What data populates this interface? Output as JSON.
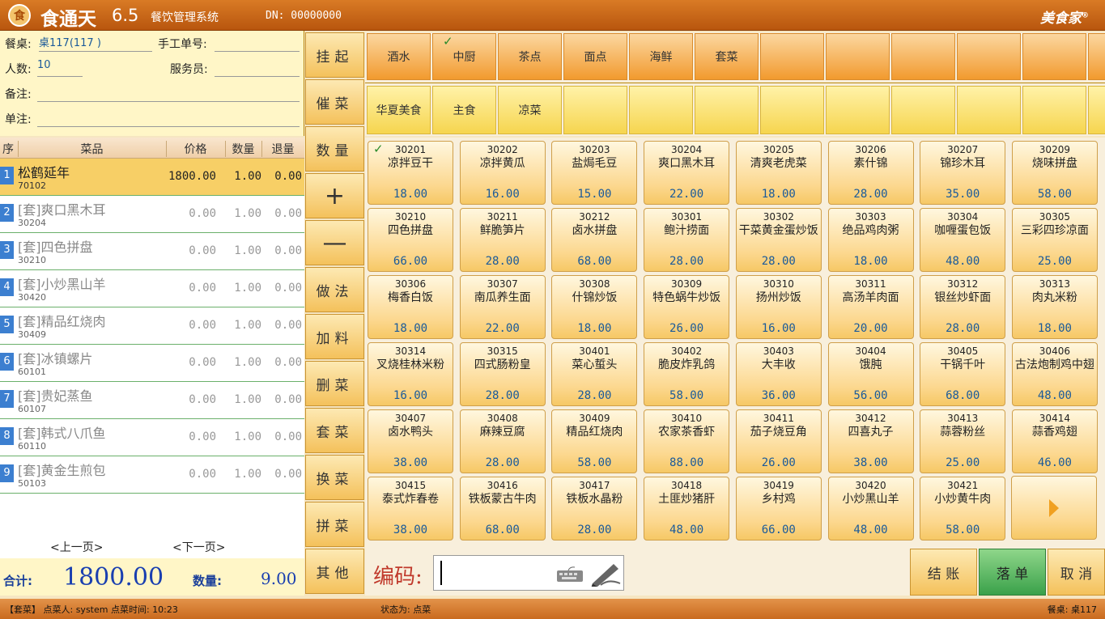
{
  "titlebar": {
    "logo_glyph": "食",
    "app_name": "食通天",
    "version": "6.5",
    "subtitle": "餐饮管理系统",
    "dn": "DN: 00000000",
    "brand": "美食家",
    "brand_mark": "®"
  },
  "order_info": {
    "table_label": "餐桌:",
    "table_value": "桌117(117 )",
    "manual_no_label": "手工单号:",
    "manual_no_value": "",
    "people_label": "人数:",
    "people_value": "10",
    "waiter_label": "服务员:",
    "waiter_value": "",
    "remark_label": "备注:",
    "remark_value": "",
    "order_note_label": "单注:",
    "order_note_value": ""
  },
  "order_grid": {
    "columns": [
      "序",
      "菜品",
      "价格",
      "数量",
      "退量"
    ],
    "rows": [
      {
        "no": "1",
        "name": "松鹤延年",
        "code": "70102",
        "price": "1800.00",
        "qty": "1.00",
        "ret": "0.00"
      },
      {
        "no": "2",
        "name": "[套]爽口黑木耳",
        "code": "30204",
        "price": "0.00",
        "qty": "1.00",
        "ret": "0.00"
      },
      {
        "no": "3",
        "name": "[套]四色拼盘",
        "code": "30210",
        "price": "0.00",
        "qty": "1.00",
        "ret": "0.00"
      },
      {
        "no": "4",
        "name": "[套]小炒黑山羊",
        "code": "30420",
        "price": "0.00",
        "qty": "1.00",
        "ret": "0.00"
      },
      {
        "no": "5",
        "name": "[套]精品红烧肉",
        "code": "30409",
        "price": "0.00",
        "qty": "1.00",
        "ret": "0.00"
      },
      {
        "no": "6",
        "name": "[套]冰镇螺片",
        "code": "60101",
        "price": "0.00",
        "qty": "1.00",
        "ret": "0.00"
      },
      {
        "no": "7",
        "name": "[套]贵妃蒸鱼",
        "code": "60107",
        "price": "0.00",
        "qty": "1.00",
        "ret": "0.00"
      },
      {
        "no": "8",
        "name": "[套]韩式八爪鱼",
        "code": "60110",
        "price": "0.00",
        "qty": "1.00",
        "ret": "0.00"
      },
      {
        "no": "9",
        "name": "[套]黄金生煎包",
        "code": "50103",
        "price": "0.00",
        "qty": "1.00",
        "ret": "0.00"
      }
    ],
    "prev_page": "<上一页>",
    "next_page": "<下一页>"
  },
  "totals": {
    "total_label": "合计:",
    "total_value": "1800.00",
    "qty_label": "数量:",
    "qty_value": "9.00"
  },
  "side_buttons": [
    "挂起",
    "催菜",
    "数量",
    "+",
    "—",
    "做法",
    "加料",
    "删菜",
    "套菜",
    "换菜",
    "拼菜",
    "其他"
  ],
  "categories_row1": [
    "酒水",
    "中厨",
    "茶点",
    "面点",
    "海鲜",
    "套菜",
    "",
    "",
    "",
    "",
    "",
    ""
  ],
  "categories_row1_checked_index": 1,
  "categories_row2": [
    "华夏美食",
    "主食",
    "凉菜",
    "",
    "",
    "",
    "",
    "",
    "",
    "",
    "",
    ""
  ],
  "dishes": [
    {
      "code": "30201",
      "name": "凉拌豆干",
      "price": "18.00",
      "checked": true
    },
    {
      "code": "30202",
      "name": "凉拌黄瓜",
      "price": "16.00"
    },
    {
      "code": "30203",
      "name": "盐焗毛豆",
      "price": "15.00"
    },
    {
      "code": "30204",
      "name": "爽口黑木耳",
      "price": "22.00"
    },
    {
      "code": "30205",
      "name": "清爽老虎菜",
      "price": "18.00"
    },
    {
      "code": "30206",
      "name": "素什锦",
      "price": "28.00"
    },
    {
      "code": "30207",
      "name": "锦珍木耳",
      "price": "35.00"
    },
    {
      "code": "30209",
      "name": "烧味拼盘",
      "price": "58.00"
    },
    {
      "code": "30210",
      "name": "四色拼盘",
      "price": "66.00"
    },
    {
      "code": "30211",
      "name": "鲜脆笋片",
      "price": "28.00"
    },
    {
      "code": "30212",
      "name": "卤水拼盘",
      "price": "68.00"
    },
    {
      "code": "30301",
      "name": "鲍汁捞面",
      "price": "28.00"
    },
    {
      "code": "30302",
      "name": "干菜黄金蛋炒饭",
      "price": "28.00"
    },
    {
      "code": "30303",
      "name": "绝品鸡肉粥",
      "price": "18.00"
    },
    {
      "code": "30304",
      "name": "咖喱蛋包饭",
      "price": "48.00"
    },
    {
      "code": "30305",
      "name": "三彩四珍凉面",
      "price": "25.00"
    },
    {
      "code": "30306",
      "name": "梅香白饭",
      "price": "18.00"
    },
    {
      "code": "30307",
      "name": "南瓜养生面",
      "price": "22.00"
    },
    {
      "code": "30308",
      "name": "什锦炒饭",
      "price": "18.00"
    },
    {
      "code": "30309",
      "name": "特色蜗牛炒饭",
      "price": "26.00"
    },
    {
      "code": "30310",
      "name": "扬州炒饭",
      "price": "16.00"
    },
    {
      "code": "30311",
      "name": "高汤羊肉面",
      "price": "20.00"
    },
    {
      "code": "30312",
      "name": "银丝炒虾面",
      "price": "28.00"
    },
    {
      "code": "30313",
      "name": "肉丸米粉",
      "price": "18.00"
    },
    {
      "code": "30314",
      "name": "叉烧桂林米粉",
      "price": "16.00"
    },
    {
      "code": "30315",
      "name": "四式肠粉皇",
      "price": "28.00"
    },
    {
      "code": "30401",
      "name": "菜心蜇头",
      "price": "28.00"
    },
    {
      "code": "30402",
      "name": "脆皮炸乳鸽",
      "price": "58.00"
    },
    {
      "code": "30403",
      "name": "大丰收",
      "price": "36.00"
    },
    {
      "code": "30404",
      "name": "饿肫",
      "price": "56.00"
    },
    {
      "code": "30405",
      "name": "干锅千叶",
      "price": "68.00"
    },
    {
      "code": "30406",
      "name": "古法炮制鸡中翅",
      "price": "48.00"
    },
    {
      "code": "30407",
      "name": "卤水鸭头",
      "price": "38.00"
    },
    {
      "code": "30408",
      "name": "麻辣豆腐",
      "price": "28.00"
    },
    {
      "code": "30409",
      "name": "精品红烧肉",
      "price": "58.00"
    },
    {
      "code": "30410",
      "name": "农家茶香虾",
      "price": "88.00"
    },
    {
      "code": "30411",
      "name": "茄子烧豆角",
      "price": "26.00"
    },
    {
      "code": "30412",
      "name": "四喜丸子",
      "price": "38.00"
    },
    {
      "code": "30413",
      "name": "蒜蓉粉丝",
      "price": "25.00"
    },
    {
      "code": "30414",
      "name": "蒜香鸡翅",
      "price": "46.00"
    },
    {
      "code": "30415",
      "name": "泰式炸春卷",
      "price": "38.00"
    },
    {
      "code": "30416",
      "name": "铁板蒙古牛肉",
      "price": "68.00"
    },
    {
      "code": "30417",
      "name": "铁板水晶粉",
      "price": "28.00"
    },
    {
      "code": "30418",
      "name": "土匪炒猪肝",
      "price": "48.00"
    },
    {
      "code": "30419",
      "name": "乡村鸡",
      "price": "66.00"
    },
    {
      "code": "30420",
      "name": "小炒黑山羊",
      "price": "48.00"
    },
    {
      "code": "30421",
      "name": "小炒黄牛肉",
      "price": "58.00"
    }
  ],
  "code_input": {
    "label": "编码:",
    "value": "",
    "keyboard_icon": "keyboard-icon",
    "handwriting_icon": "pen-icon"
  },
  "actions": {
    "checkout": "结 账",
    "submit": "落 单",
    "cancel": "取 消"
  },
  "status": {
    "left": "【套菜】 点菜人: system  点菜时间: 10:23",
    "middle": "状态为: 点菜",
    "right": "餐桌: 桌117"
  },
  "colors": {
    "title_bg": "#c96a1e",
    "selected_row": "#f7cf66",
    "submit_button": "#3aa14a",
    "price_blue": "#1a5a9a"
  }
}
